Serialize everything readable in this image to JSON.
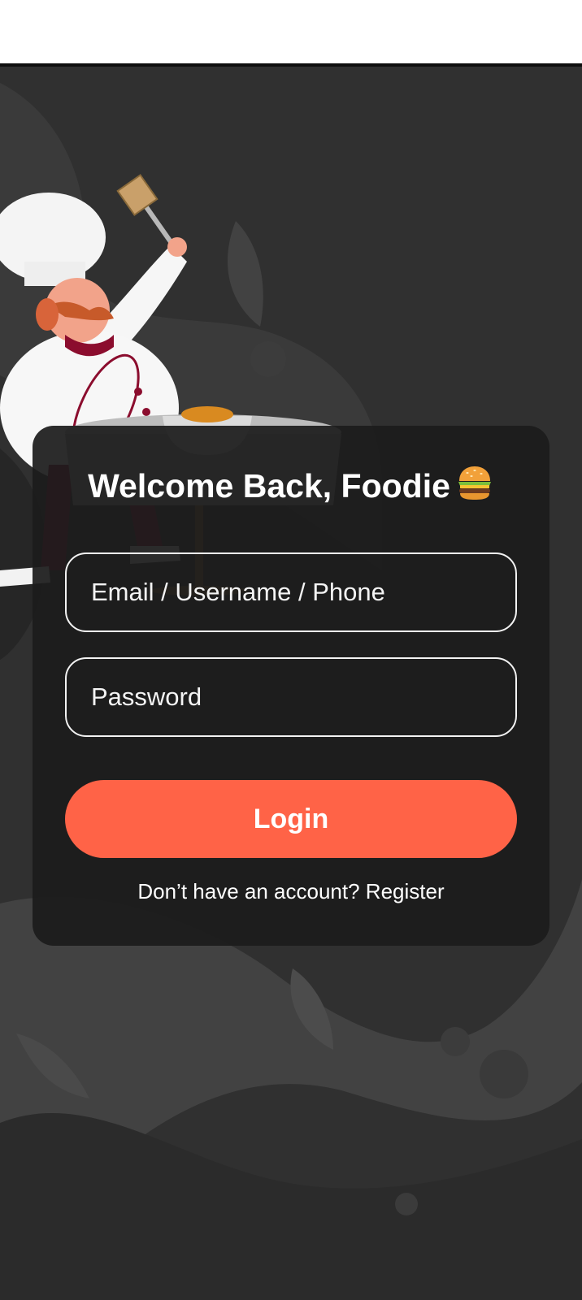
{
  "login": {
    "title": "Welcome Back, Foodie",
    "title_emoji_icon": "burger-icon",
    "email_placeholder": "Email / Username / Phone",
    "password_placeholder": "Password",
    "login_label": "Login",
    "register_prompt": "Don’t have an account?",
    "register_link": "Register"
  },
  "colors": {
    "accent": "#ff6347",
    "background": "#303030",
    "card": "#1c1c1c",
    "text": "#ffffff"
  }
}
